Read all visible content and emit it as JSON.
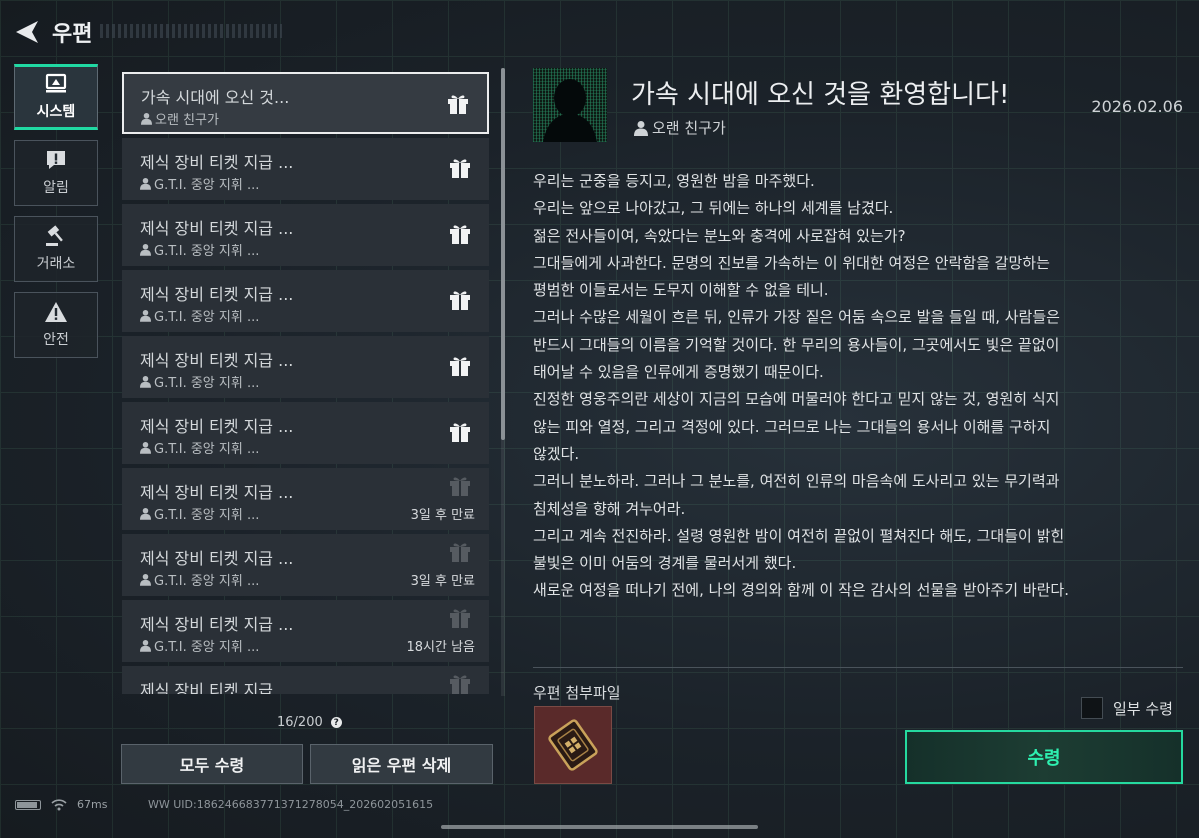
{
  "header": {
    "title": "우편"
  },
  "tabs": [
    {
      "label": "시스템",
      "icon": "system-icon",
      "active": true
    },
    {
      "label": "알림",
      "icon": "notice-icon",
      "active": false
    },
    {
      "label": "거래소",
      "icon": "gavel-icon",
      "active": false
    },
    {
      "label": "안전",
      "icon": "warning-icon",
      "active": false
    }
  ],
  "mails": [
    {
      "subject": "가속 시대에 오신 것...",
      "sender": "오랜 친구가",
      "gift": "active",
      "expiry": ""
    },
    {
      "subject": "제식 장비 티켓 지급 ...",
      "sender": "G.T.I. 중앙 지휘 ...",
      "gift": "active",
      "expiry": ""
    },
    {
      "subject": "제식 장비 티켓 지급 ...",
      "sender": "G.T.I. 중앙 지휘 ...",
      "gift": "active",
      "expiry": ""
    },
    {
      "subject": "제식 장비 티켓 지급 ...",
      "sender": "G.T.I. 중앙 지휘 ...",
      "gift": "active",
      "expiry": ""
    },
    {
      "subject": "제식 장비 티켓 지급 ...",
      "sender": "G.T.I. 중앙 지휘 ...",
      "gift": "active",
      "expiry": ""
    },
    {
      "subject": "제식 장비 티켓 지급 ...",
      "sender": "G.T.I. 중앙 지휘 ...",
      "gift": "active",
      "expiry": ""
    },
    {
      "subject": "제식 장비 티켓 지급 ...",
      "sender": "G.T.I. 중앙 지휘 ...",
      "gift": "dim",
      "expiry": "3일 후 만료"
    },
    {
      "subject": "제식 장비 티켓 지급 ...",
      "sender": "G.T.I. 중앙 지휘 ...",
      "gift": "dim",
      "expiry": "3일 후 만료"
    },
    {
      "subject": "제식 장비 티켓 지급 ...",
      "sender": "G.T.I. 중앙 지휘 ...",
      "gift": "dim",
      "expiry": "18시간 남음"
    },
    {
      "subject": "제식 장비 티켓 지급",
      "sender": "",
      "gift": "dim",
      "expiry": ""
    }
  ],
  "mail_count": "16/200",
  "buttons": {
    "receive_all": "모두 수령",
    "delete_read": "읽은 우편 삭제",
    "receive": "수령",
    "partial": "일부 수령"
  },
  "detail": {
    "title": "가속 시대에 오신 것을 환영합니다!",
    "sender": "오랜 친구가",
    "date": "2026.02.06",
    "body": [
      "우리는 군중을 등지고, 영원한 밤을 마주했다.",
      "우리는 앞으로 나아갔고, 그 뒤에는 하나의 세계를 남겼다.",
      "젊은 전사들이여, 속았다는 분노와 충격에 사로잡혀 있는가?",
      "그대들에게 사과한다. 문명의 진보를 가속하는 이 위대한 여정은 안락함을 갈망하는",
      "평범한 이들로서는 도무지 이해할 수 없을 테니.",
      "그러나 수많은 세월이 흐른 뒤, 인류가 가장 짙은 어둠 속으로 발을 들일 때, 사람들은",
      "반드시 그대들의 이름을 기억할 것이다. 한 무리의 용사들이, 그곳에서도 빛은 끝없이",
      "태어날 수 있음을 인류에게 증명했기 때문이다.",
      "진정한 영웅주의란 세상이 지금의 모습에 머물러야 한다고 믿지 않는 것, 영원히 식지",
      "않는 피와 열정, 그리고 격정에 있다. 그러므로 나는 그대들의 용서나 이해를 구하지",
      "않겠다.",
      "그러니 분노하라. 그러나 그 분노를, 여전히 인류의 마음속에 도사리고 있는 무기력과",
      "침체성을 향해 겨누어라.",
      "그리고 계속 전진하라. 설령 영원한 밤이 여전히 끝없이 펼쳐진다 해도, 그대들이 밝힌",
      "불빛은 이미 어둠의 경계를 물러서게 했다.",
      "새로운 여정을 떠나기 전에, 나의 경의와 함께 이 작은 감사의 선물을 받아주기 바란다."
    ],
    "attachment_label": "우편 첨부파일",
    "attachment_icon": "ticket-card-icon"
  },
  "status": {
    "latency": "67ms",
    "uid": "WW UID:1862466837713712780​54_202602051615"
  },
  "colors": {
    "accent": "#20d9a3",
    "background": "#1b2127"
  }
}
